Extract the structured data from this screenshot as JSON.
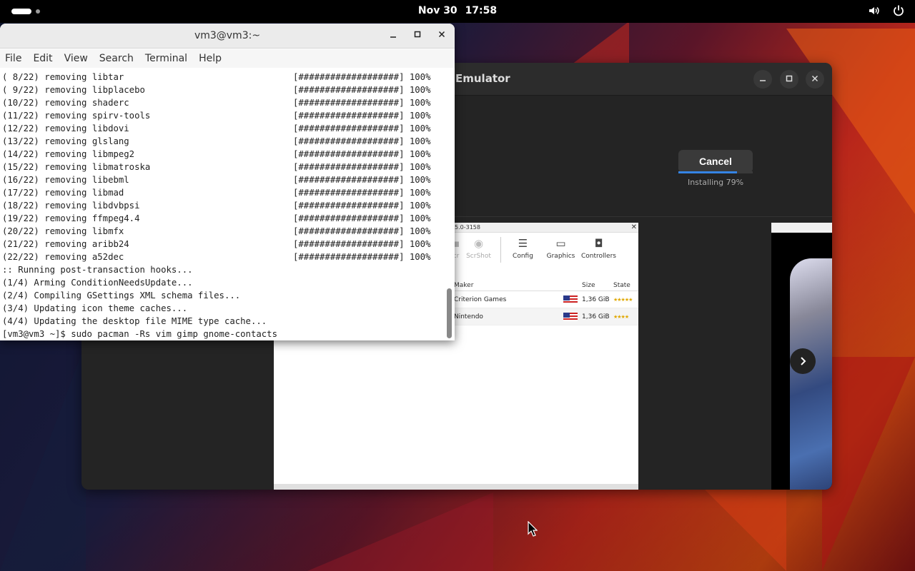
{
  "topbar": {
    "date": "Nov 30",
    "time": "17:58",
    "icons": [
      "activities-indicator",
      "volume-icon",
      "power-icon"
    ]
  },
  "background_window": {
    "title": "Emulator",
    "cancel_label": "Cancel",
    "install_status": "Installing 79%",
    "install_progress": 0.79,
    "screenshot": {
      "window_title": "5.0-3158",
      "toolbar": [
        "ScrShot",
        "Config",
        "Graphics",
        "Controllers"
      ],
      "toolbar_partial": "cr",
      "columns": {
        "maker": "Maker",
        "size": "Size",
        "state": "State"
      },
      "rows": [
        {
          "maker": "Criterion Games",
          "size": "1,36 GiB",
          "state": "★★★★★"
        },
        {
          "maker": "Nintendo",
          "size": "1,36 GiB",
          "state": "★★★★"
        }
      ]
    }
  },
  "terminal": {
    "title": "vm3@vm3:~",
    "menu": [
      "File",
      "Edit",
      "View",
      "Search",
      "Terminal",
      "Help"
    ],
    "lines": [
      {
        "text": "( 8/22) removing libtar",
        "bar": "[###################] 100%"
      },
      {
        "text": "( 9/22) removing libplacebo",
        "bar": "[###################] 100%"
      },
      {
        "text": "(10/22) removing shaderc",
        "bar": "[###################] 100%"
      },
      {
        "text": "(11/22) removing spirv-tools",
        "bar": "[###################] 100%"
      },
      {
        "text": "(12/22) removing libdovi",
        "bar": "[###################] 100%"
      },
      {
        "text": "(13/22) removing glslang",
        "bar": "[###################] 100%"
      },
      {
        "text": "(14/22) removing libmpeg2",
        "bar": "[###################] 100%"
      },
      {
        "text": "(15/22) removing libmatroska",
        "bar": "[###################] 100%"
      },
      {
        "text": "(16/22) removing libebml",
        "bar": "[###################] 100%"
      },
      {
        "text": "(17/22) removing libmad",
        "bar": "[###################] 100%"
      },
      {
        "text": "(18/22) removing libdvbpsi",
        "bar": "[###################] 100%"
      },
      {
        "text": "(19/22) removing ffmpeg4.4",
        "bar": "[###################] 100%"
      },
      {
        "text": "(20/22) removing libmfx",
        "bar": "[###################] 100%"
      },
      {
        "text": "(21/22) removing aribb24",
        "bar": "[###################] 100%"
      },
      {
        "text": "(22/22) removing a52dec",
        "bar": "[###################] 100%"
      },
      {
        "text": ":: Running post-transaction hooks...",
        "bar": ""
      },
      {
        "text": "(1/4) Arming ConditionNeedsUpdate...",
        "bar": ""
      },
      {
        "text": "(2/4) Compiling GSettings XML schema files...",
        "bar": ""
      },
      {
        "text": "(3/4) Updating icon theme caches...",
        "bar": ""
      },
      {
        "text": "(4/4) Updating the desktop file MIME type cache...",
        "bar": ""
      },
      {
        "text": "[vm3@vm3 ~]$ sudo pacman -Rs vim gimp gnome-contacts",
        "bar": ""
      }
    ]
  }
}
